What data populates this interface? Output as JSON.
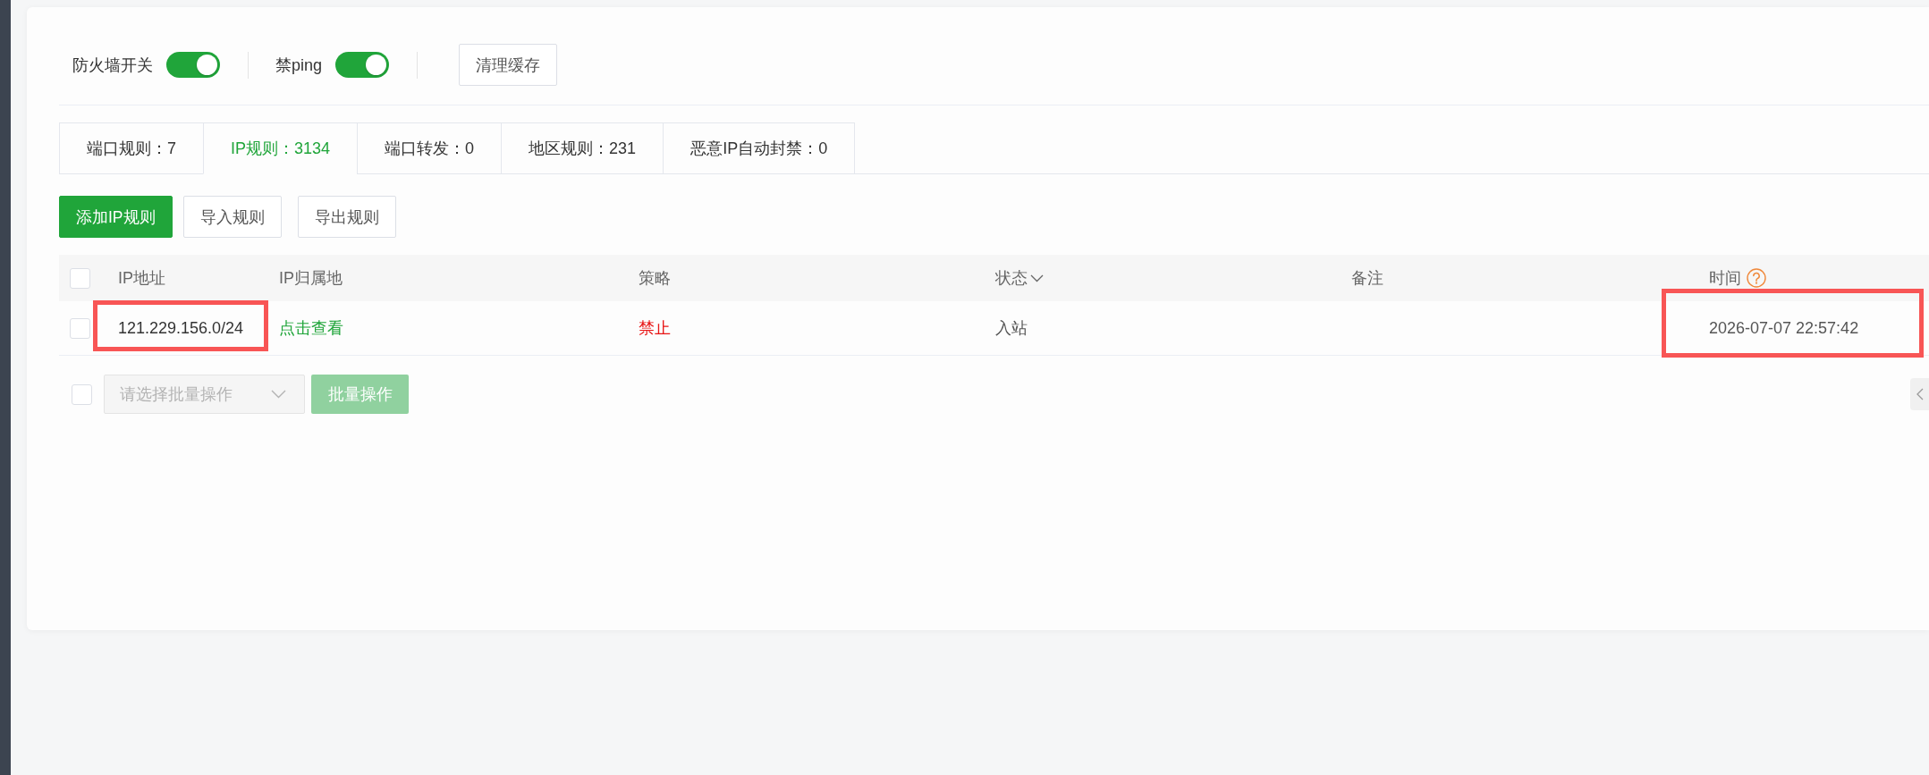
{
  "toolbar": {
    "toggles": [
      {
        "label": "防火墙开关",
        "on": true
      },
      {
        "label": "禁ping",
        "on": true
      }
    ],
    "clear_cache_button": "清理缓存"
  },
  "tabs": [
    {
      "label": "端口规则：7",
      "selected": false
    },
    {
      "label": "IP规则：3134",
      "selected": true
    },
    {
      "label": "端口转发：0",
      "selected": false
    },
    {
      "label": "地区规则：231",
      "selected": false
    },
    {
      "label": "恶意IP自动封禁：0",
      "selected": false
    }
  ],
  "actions": [
    {
      "label": "添加IP规则",
      "kind": "primary"
    },
    {
      "label": "导入规则",
      "kind": "default"
    },
    {
      "label": "导出规则",
      "kind": "default"
    }
  ],
  "table": {
    "select_all": {
      "checked": false
    },
    "columns": [
      {
        "label": "IP地址",
        "kind": "plain",
        "highlighted": true
      },
      {
        "label": "IP归属地",
        "kind": "plain",
        "highlighted": false
      },
      {
        "label": "策略",
        "kind": "plain",
        "highlighted": false
      },
      {
        "label": "状态",
        "kind": "dropdown",
        "highlighted": false
      },
      {
        "label": "备注",
        "kind": "plain",
        "highlighted": false
      },
      {
        "label": "时间",
        "kind": "help",
        "highlighted": true
      }
    ],
    "rows": [
      {
        "checked": false,
        "ip_address": "121.229.156.0/24",
        "location": "点击查看",
        "policy": "禁止",
        "blocked": true,
        "direction": "入站",
        "time": "2026-07-07 22:57:42"
      }
    ]
  },
  "batch_bar": {
    "checked": false,
    "select": {
      "placeholder": "请选择批量操作",
      "disabled": true
    },
    "button": {
      "label": "批量操作",
      "disabled": true
    }
  }
}
